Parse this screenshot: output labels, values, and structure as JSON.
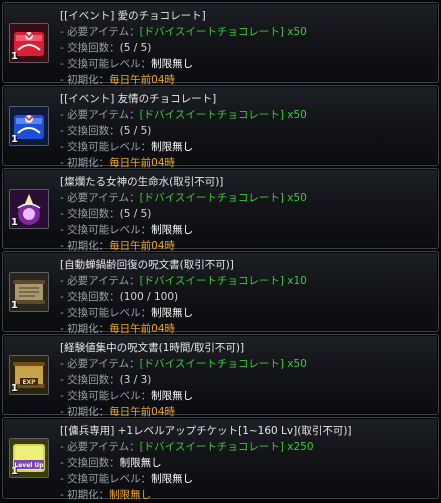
{
  "labels": {
    "item": "- 必要アイテム：",
    "count": "- 交換回数：",
    "level": "- 交換可能レベル：",
    "reset": "- 初期化："
  },
  "entries": [
    {
      "title": "[[イベント] 愛のチョコレート]",
      "required_item": "[ドバイスイートチョコレート] x50",
      "count": "(5 / 5)",
      "level": "制限無し",
      "reset": "毎日午前04時",
      "quantity": "1",
      "icon": "red-chocolate-box-icon"
    },
    {
      "title": "[[イベント] 友情のチョコレート]",
      "required_item": "[ドバイスイートチョコレート] x50",
      "count": "(5 / 5)",
      "level": "制限無し",
      "reset": "毎日午前04時",
      "quantity": "1",
      "icon": "blue-chocolate-box-icon"
    },
    {
      "title": "[燦爛たる女神の生命水(取引不可)]",
      "required_item": "[ドバイスイートチョコレート] x50",
      "count": "(5 / 5)",
      "level": "制限無し",
      "reset": "毎日午前04時",
      "quantity": "1",
      "icon": "goddess-water-icon"
    },
    {
      "title": "[自動蝉鍋齢回復の呪文書(取引不可)]",
      "required_item": "[ドバイスイートチョコレート] x10",
      "count": "(100 / 100)",
      "level": "制限無し",
      "reset": "毎日午前04時",
      "quantity": "1",
      "icon": "scroll-icon"
    },
    {
      "title": "[経験値集中の呪文書(1時間/取引不可)]",
      "required_item": "[ドバイスイートチョコレート] x50",
      "count": "(3 / 3)",
      "level": "制限無し",
      "reset": "毎日午前04時",
      "quantity": "1",
      "icon": "exp-scroll-icon"
    },
    {
      "title": "[[傭兵専用] +1レベルアップチケット[1~160 Lv](取引不可)]",
      "required_item": "[ドバイスイートチョコレート] x250",
      "count": "制限無し",
      "level": "制限無し",
      "reset": "制限無し",
      "quantity": "1",
      "icon": "level-up-ticket-icon",
      "icon_text": "Level Up"
    }
  ],
  "colors": {
    "item_green": "#3ccc38",
    "reset_orange": "#f0a91c",
    "border": "#3e434a"
  }
}
